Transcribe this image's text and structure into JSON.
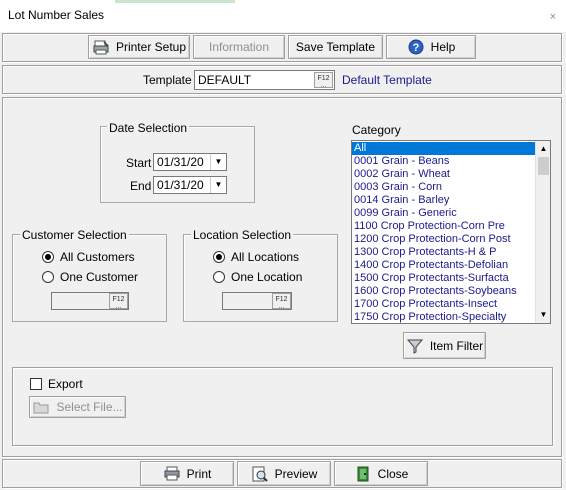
{
  "window": {
    "title": "Lot Number Sales",
    "close_glyph": "×"
  },
  "toolbar": {
    "printer_setup": "Printer Setup",
    "information": "Information",
    "save_template": "Save Template",
    "help": "Help"
  },
  "template": {
    "label": "Template",
    "value": "DEFAULT",
    "f12": "F12",
    "description": "Default Template"
  },
  "date_selection": {
    "title": "Date Selection",
    "start_label": "Start",
    "start_value": "01/31/20",
    "end_label": "End",
    "end_value": "01/31/20"
  },
  "customer_selection": {
    "title": "Customer Selection",
    "all_label": "All Customers",
    "one_label": "One Customer",
    "selected": "all",
    "f12": "F12"
  },
  "location_selection": {
    "title": "Location Selection",
    "all_label": "All Locations",
    "one_label": "One Location",
    "selected": "all",
    "f12": "F12"
  },
  "category": {
    "label": "Category",
    "items": [
      "All",
      "0001 Grain - Beans",
      "0002 Grain - Wheat",
      "0003 Grain - Corn",
      "0014 Grain - Barley",
      "0099 Grain - Generic",
      "1100 Crop Protection-Corn Pre",
      "1200 Crop Protection-Corn Post",
      "1300 Crop Protectants-H & P",
      "1400 Crop Protectants-Defolian",
      "1500 Crop Protectants-Surfacta",
      "1600 Crop Protectants-Soybeans",
      "1700 Crop Protectants-Insect",
      "1750 Crop Protection-Specialty"
    ],
    "selected_index": 0
  },
  "item_filter": {
    "label": "Item Filter"
  },
  "export": {
    "label": "Export",
    "checked": false,
    "select_file": "Select File..."
  },
  "footer": {
    "print": "Print",
    "preview": "Preview",
    "close": "Close"
  },
  "colors": {
    "accent": "#0078d7",
    "link": "#1a1a8c"
  }
}
